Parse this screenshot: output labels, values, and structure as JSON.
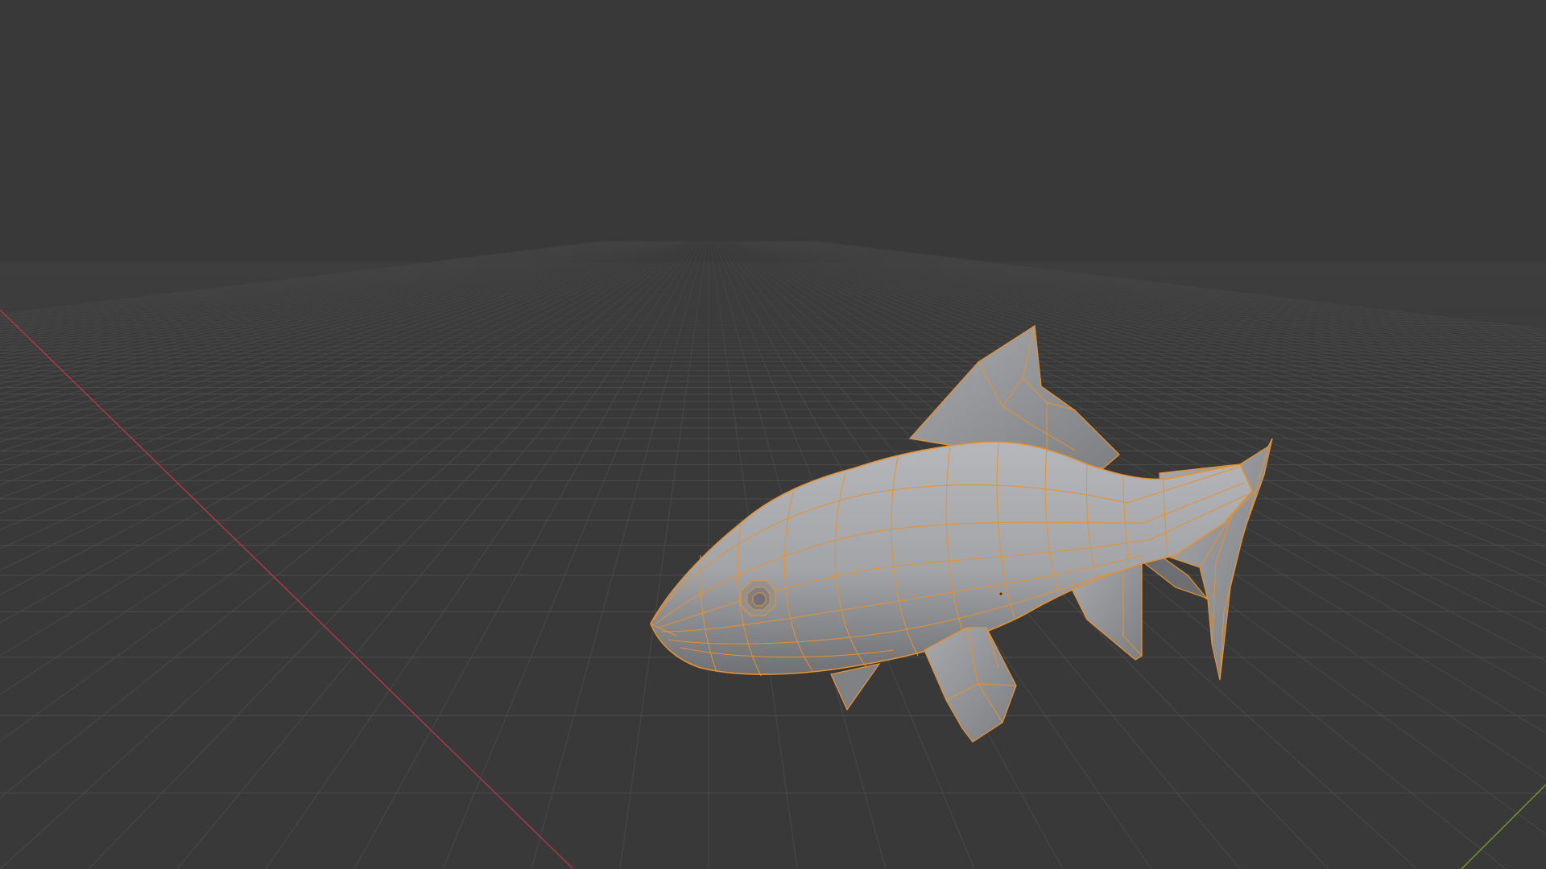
{
  "viewport": {
    "background_color": "#393939",
    "grid_color": "#4b4b4b",
    "grid_minor_color": "#424242",
    "x_axis_color": "#b33845",
    "y_axis_color": "#6f9a2c",
    "object_name": "fish-mesh",
    "object_face_color": "#9a9c9f",
    "object_face_highlight": "#b4b6b9",
    "object_face_shadow": "#6f7174",
    "object_edge_color": "#e8912f",
    "selected": true,
    "mode": "edit",
    "view": "perspective"
  }
}
